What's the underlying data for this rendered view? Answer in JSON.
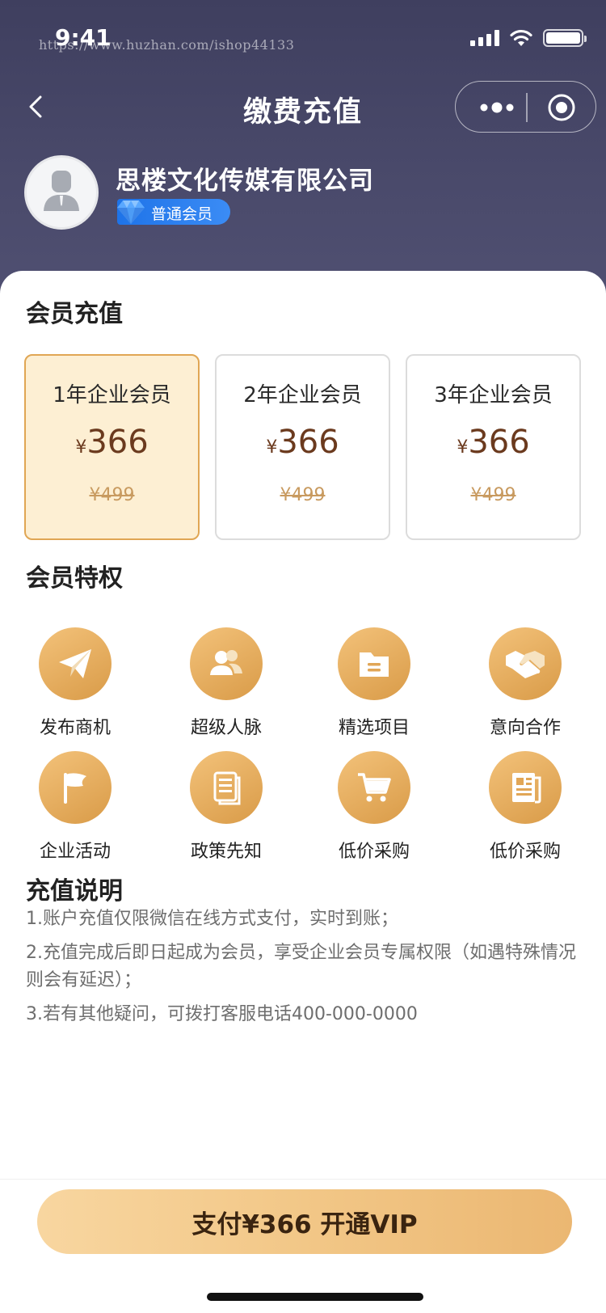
{
  "status_bar": {
    "time": "9:41",
    "watermark": "https://www.huzhan.com/ishop44133"
  },
  "nav": {
    "title": "缴费充值"
  },
  "profile": {
    "company": "思楼文化传媒有限公司",
    "level": "普通会员"
  },
  "recharge": {
    "title": "会员充值",
    "plans": [
      {
        "name": "1年企业会员",
        "currency": "¥",
        "price": "366",
        "original": "¥499",
        "selected": true
      },
      {
        "name": "2年企业会员",
        "currency": "¥",
        "price": "366",
        "original": "¥499",
        "selected": false
      },
      {
        "name": "3年企业会员",
        "currency": "¥",
        "price": "366",
        "original": "¥499",
        "selected": false
      }
    ]
  },
  "perks": {
    "title": "会员特权",
    "items": [
      {
        "label": "发布商机",
        "icon": "paper-plane-icon"
      },
      {
        "label": "超级人脉",
        "icon": "contacts-icon"
      },
      {
        "label": "精选项目",
        "icon": "folder-icon"
      },
      {
        "label": "意向合作",
        "icon": "handshake-icon"
      },
      {
        "label": "企业活动",
        "icon": "flag-icon"
      },
      {
        "label": "政策先知",
        "icon": "document-icon"
      },
      {
        "label": "低价采购",
        "icon": "cart-icon"
      },
      {
        "label": "低价采购",
        "icon": "newspaper-icon"
      }
    ]
  },
  "notes": {
    "title": "充值说明",
    "lines": [
      "1.账户充值仅限微信在线方式支付，实时到账；",
      "2.充值完成后即日起成为会员，享受企业会员专属权限（如遇特殊情况则会有延迟）；",
      "3.若有其他疑问，可拨打客服电话400-000-0000"
    ]
  },
  "pay": {
    "label": "支付¥366 开通VIP"
  },
  "colors": {
    "header_bg": "#45456a",
    "accent_gold": "#e0a654",
    "badge_blue": "#1e73e8",
    "price_brown": "#6b3a1e"
  }
}
